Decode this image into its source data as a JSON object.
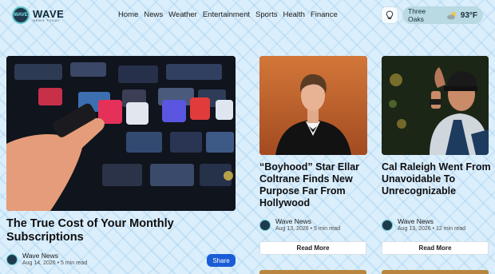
{
  "brand": {
    "name": "WAVE",
    "tagline": "NEWS TODAY",
    "badge_text": "WAVE",
    "accent": "#5fc3c9"
  },
  "nav": {
    "items": [
      "Home",
      "News",
      "Weather",
      "Entertainment",
      "Sports",
      "Health",
      "Finance"
    ]
  },
  "header": {
    "bulb_icon": "lightbulb-icon",
    "weather": {
      "location": "Three Oaks",
      "temp": "93°F",
      "icon": "partly-cloudy-icon"
    }
  },
  "articles": {
    "main": {
      "title": "The True Cost of Your Monthly Subscriptions",
      "author": "Wave News",
      "date": "Aug 14, 2026",
      "read_time": "5 min read",
      "action": "Share"
    },
    "mid": {
      "title": "“Boyhood” Star Ellar Coltrane Finds New Purpose Far From Hollywood",
      "author": "Wave News",
      "date": "Aug 13, 2026",
      "read_time": "5 min read",
      "action": "Read More"
    },
    "right": {
      "title": "Cal Raleigh Went From Unavoidable To Unrecognizable",
      "author": "Wave News",
      "date": "Aug 13, 2026",
      "read_time": "12 min read",
      "action": "Read More"
    }
  },
  "colors": {
    "background": "#dbeefb",
    "share_button": "#1a5cd6"
  }
}
